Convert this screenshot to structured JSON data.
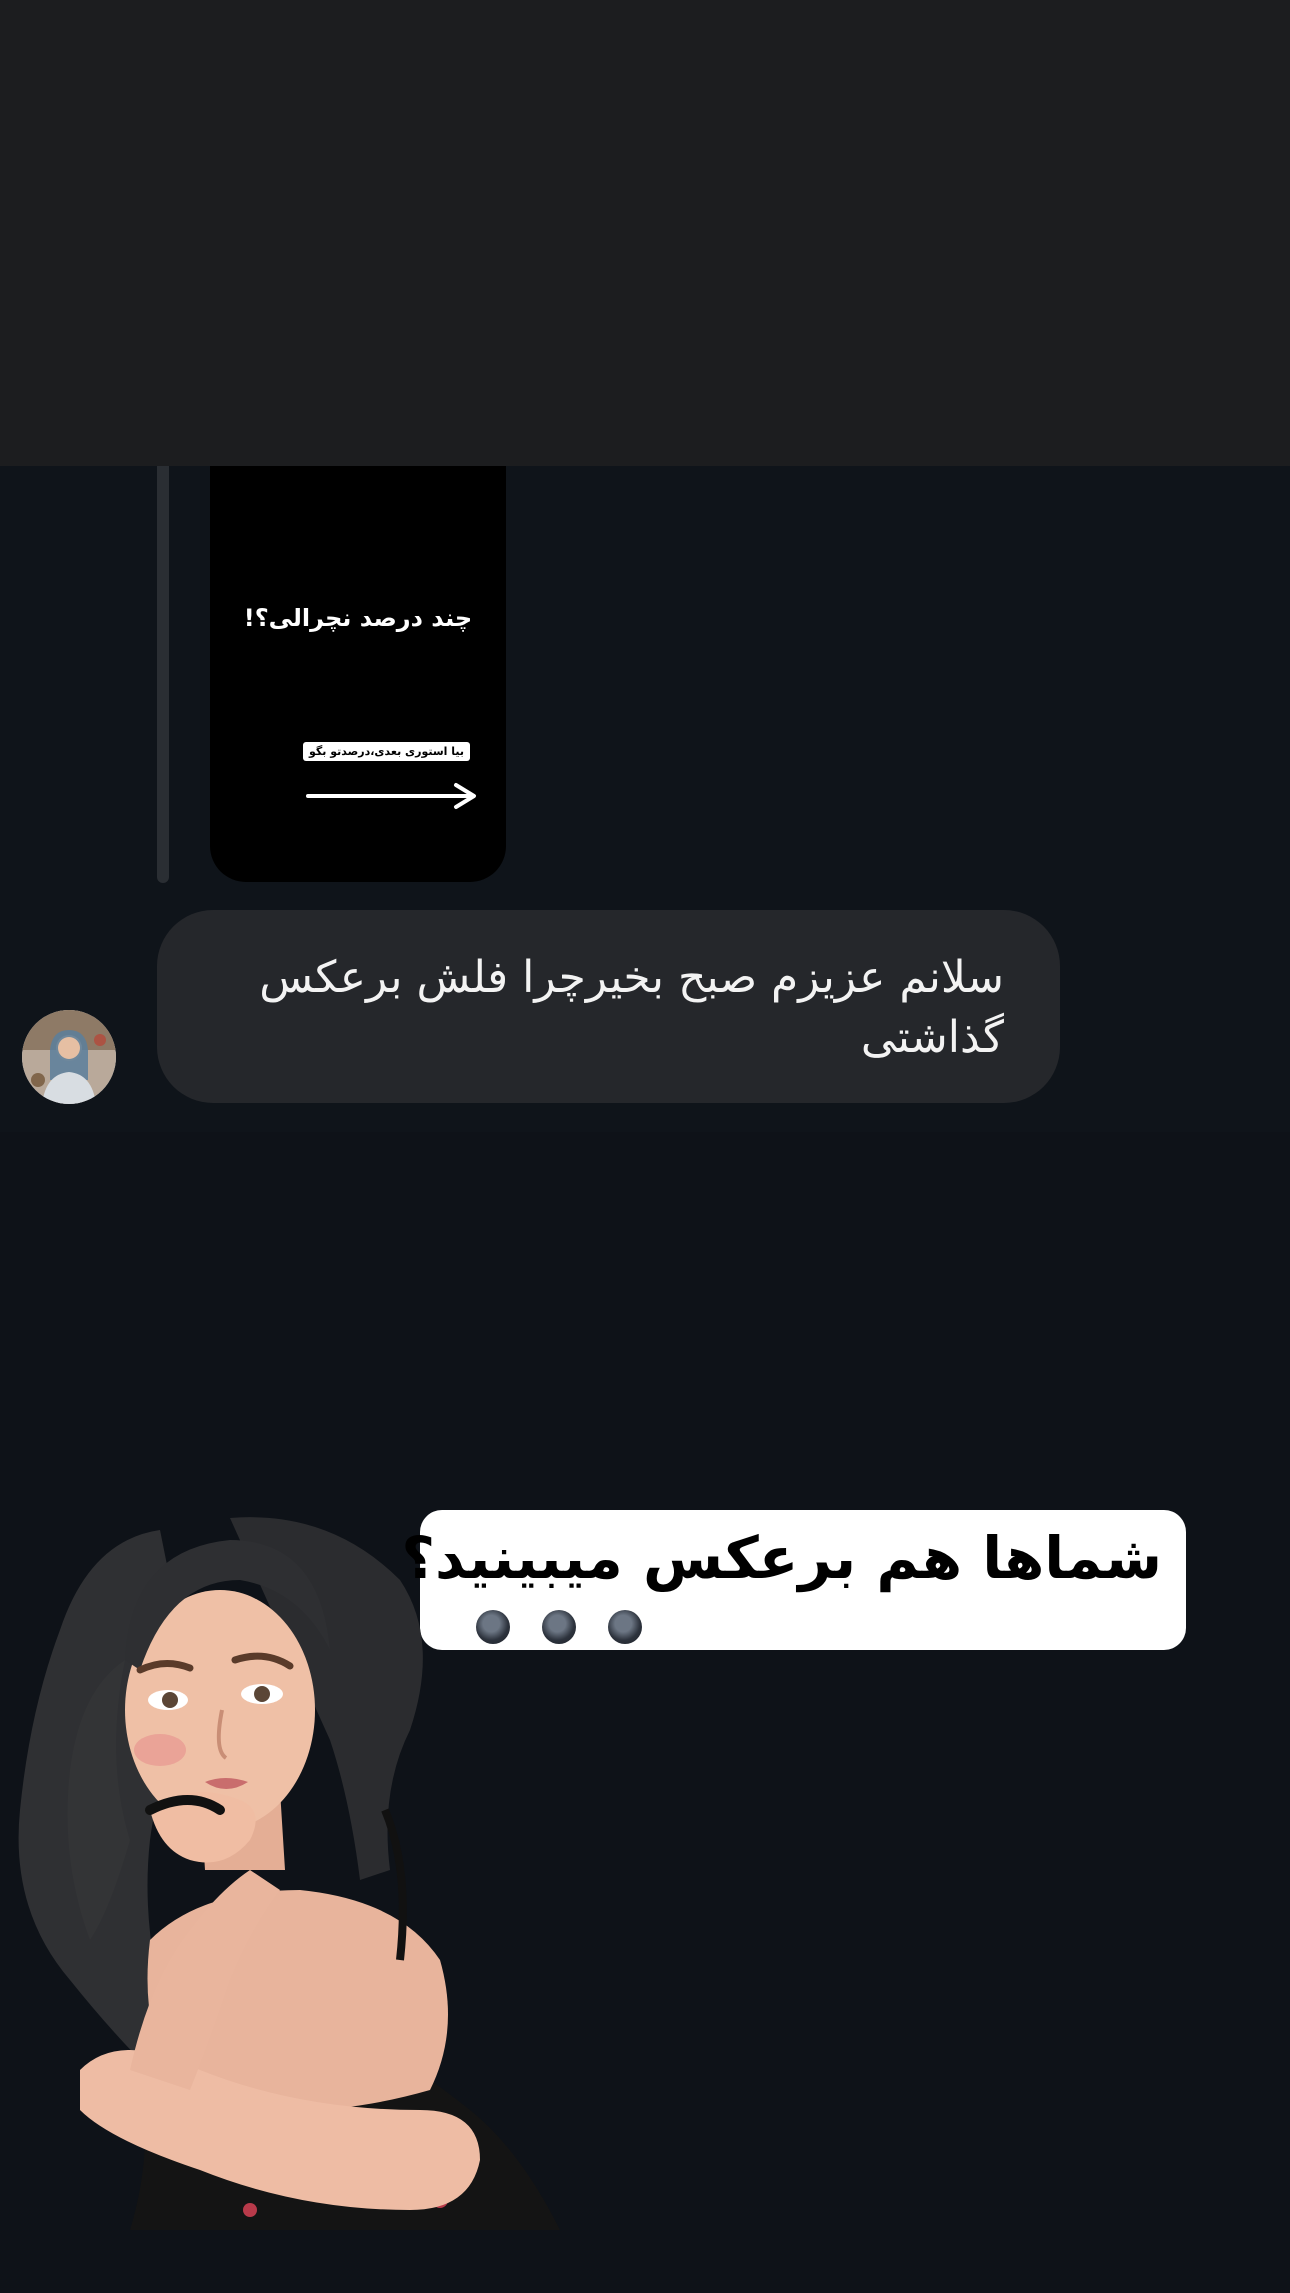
{
  "story": {
    "title": "چند درصد نچرالی؟!",
    "hint": "بیا استوری بعدی،درصدتو بگو"
  },
  "message": {
    "text": "سلانم عزیزم صبح بخیرچرا فلش برعکس گذاشتی"
  },
  "overlay": {
    "question": "شماها هم برعکس میبینید؟",
    "dot_count": 3
  },
  "icons": {
    "arrow": "right-arrow-icon",
    "avatar": "profile-avatar",
    "character": "avatar-sticker-woman-thinking"
  }
}
